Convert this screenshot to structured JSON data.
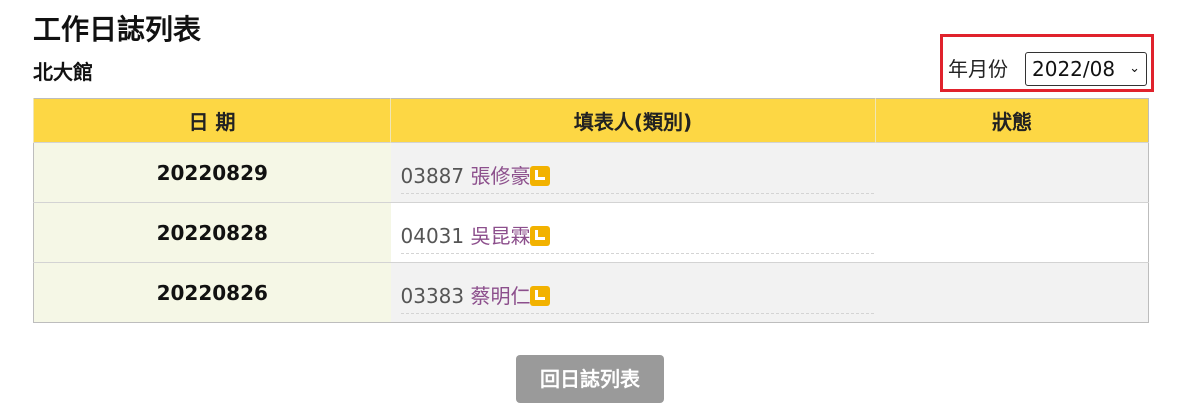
{
  "page": {
    "title": "工作日誌列表",
    "branch": "北大館"
  },
  "filter": {
    "label": "年月份",
    "selected_month": "2022/08"
  },
  "table": {
    "columns": [
      "日 期",
      "填表人(類別)",
      "狀態"
    ],
    "rows": [
      {
        "date": "20220829",
        "person_id": "03887",
        "person_name": "張修豪",
        "status": ""
      },
      {
        "date": "20220828",
        "person_id": "04031",
        "person_name": "吳昆霖",
        "status": ""
      },
      {
        "date": "20220826",
        "person_id": "03383",
        "person_name": "蔡明仁",
        "status": ""
      }
    ]
  },
  "actions": {
    "back_label": "回日誌列表"
  },
  "colors": {
    "header_bg": "#fdd744",
    "highlight_border": "#e0222c",
    "name_link": "#8c4f8c",
    "edit_icon": "#f2b200",
    "back_button": "#9a9a9a"
  },
  "icons": {
    "edit": "edit-icon",
    "dropdown": "chevron-down-icon"
  }
}
